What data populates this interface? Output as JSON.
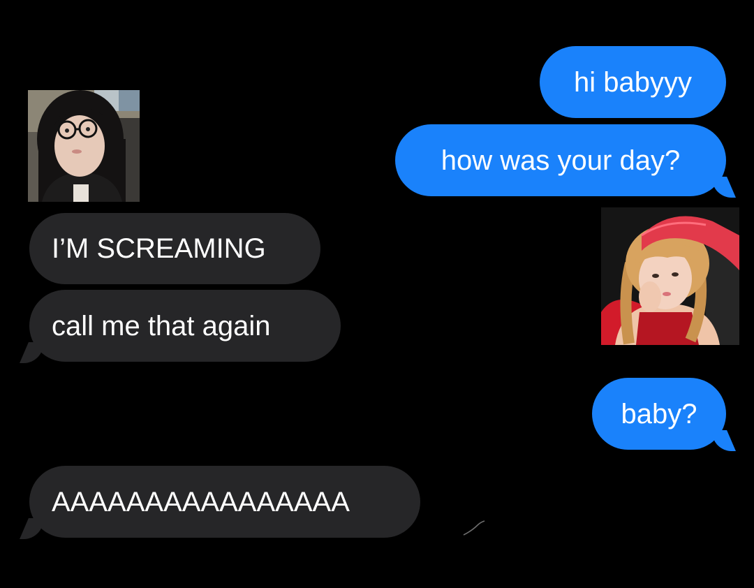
{
  "colors": {
    "background": "#000000",
    "sent_bubble": "#1a82fb",
    "received_bubble": "#262628",
    "text": "#ffffff"
  },
  "conversation": {
    "messages": [
      {
        "direction": "sent",
        "text": "hi babyyy"
      },
      {
        "direction": "sent",
        "text": "how was your day?"
      },
      {
        "direction": "received",
        "text": "I’M SCREAMING"
      },
      {
        "direction": "received",
        "text": "call me that again"
      },
      {
        "direction": "sent",
        "text": "baby?"
      },
      {
        "direction": "received",
        "text": "AAAAAAAAAAAAAAAA"
      }
    ],
    "avatars": [
      {
        "side": "left",
        "description_icon": "contact-photo-dark-hair-glasses"
      },
      {
        "side": "right",
        "description_icon": "contact-photo-red-cap-braids"
      }
    ]
  }
}
